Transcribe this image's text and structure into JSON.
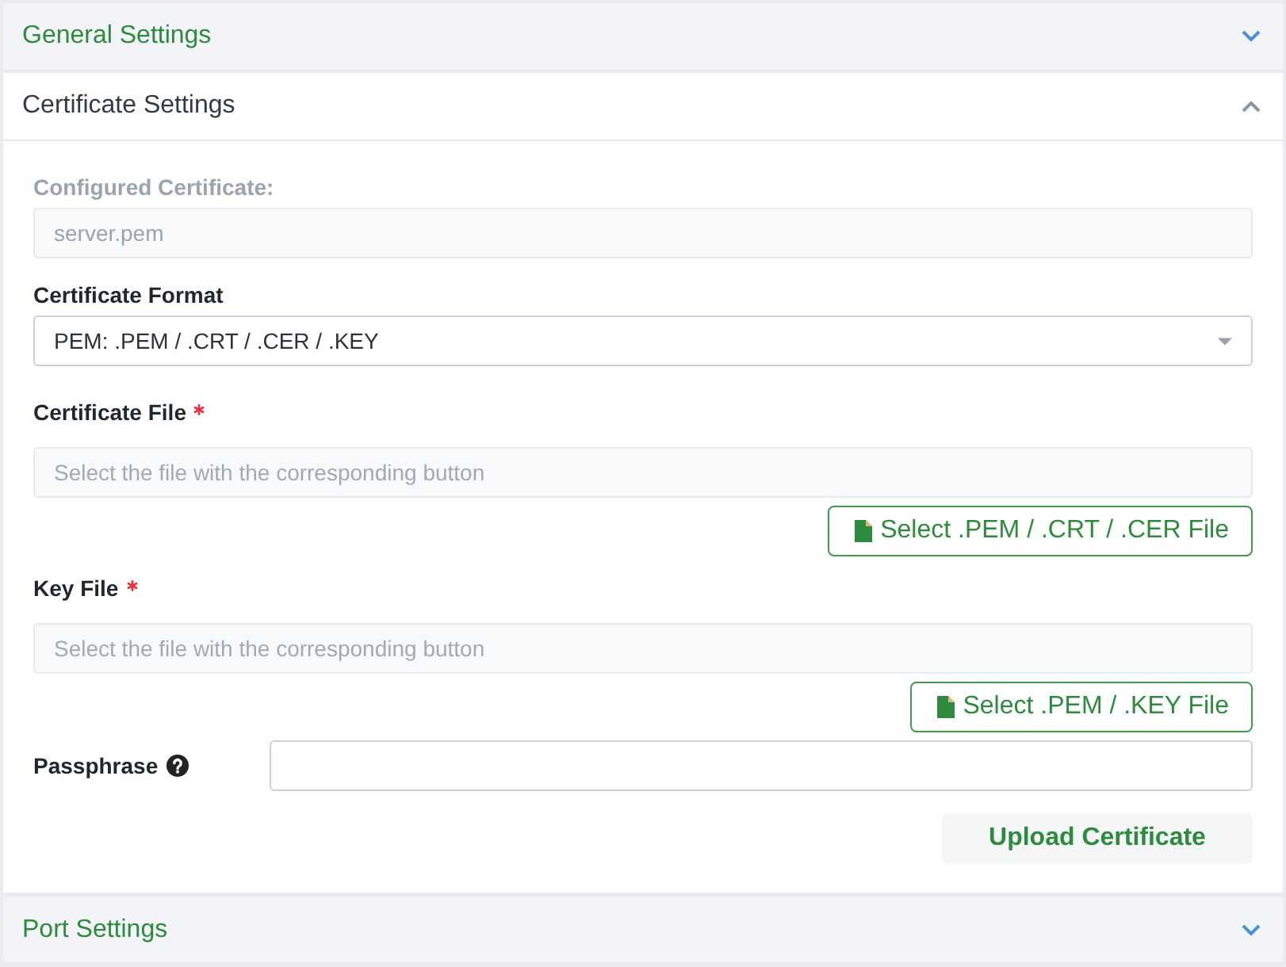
{
  "sections": [
    {
      "title": "General Settings",
      "expanded": false
    },
    {
      "title": "Certificate Settings",
      "expanded": true,
      "fields": [
        {
          "kind": "readonly",
          "label": "Configured Certificate:",
          "value": "server.pem"
        },
        {
          "kind": "select",
          "label": "Certificate Format",
          "value": "PEM: .PEM / .CRT / .CER / .KEY"
        },
        {
          "kind": "file",
          "label": "Certificate File",
          "required": true,
          "placeholder": "Select the file with the corresponding button",
          "button": "Select .PEM / .CRT / .CER File"
        },
        {
          "kind": "file",
          "label": "Key File",
          "required": true,
          "placeholder": "Select the file with the corresponding button",
          "button": "Select .PEM / .KEY File"
        },
        {
          "kind": "password",
          "label": "Passphrase",
          "help": true
        }
      ],
      "submit": "Upload Certificate"
    },
    {
      "title": "Port Settings",
      "expanded": false
    }
  ]
}
